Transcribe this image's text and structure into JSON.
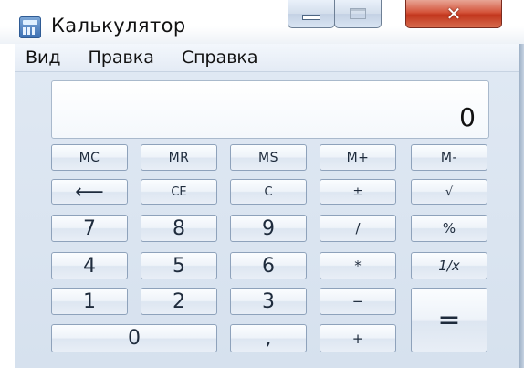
{
  "window": {
    "title": "Калькулятор",
    "close_glyph": "✕"
  },
  "menu": {
    "items": [
      "Вид",
      "Правка",
      "Справка"
    ]
  },
  "display": {
    "value": "0"
  },
  "keys": {
    "row1": [
      "MC",
      "MR",
      "MS",
      "M+",
      "M-"
    ],
    "row2": [
      "⟵",
      "CE",
      "C",
      "±",
      "√"
    ],
    "row3": [
      "7",
      "8",
      "9",
      "/",
      "%"
    ],
    "row4": [
      "4",
      "5",
      "6",
      "*",
      "1/x"
    ],
    "row5": [
      "1",
      "2",
      "3",
      "−"
    ],
    "row6": [
      "0",
      ",",
      "+"
    ],
    "equals": "="
  },
  "icons": {
    "app": "calculator-icon",
    "minimize": "minimize-icon",
    "maximize": "maximize-icon",
    "close": "close-icon"
  }
}
